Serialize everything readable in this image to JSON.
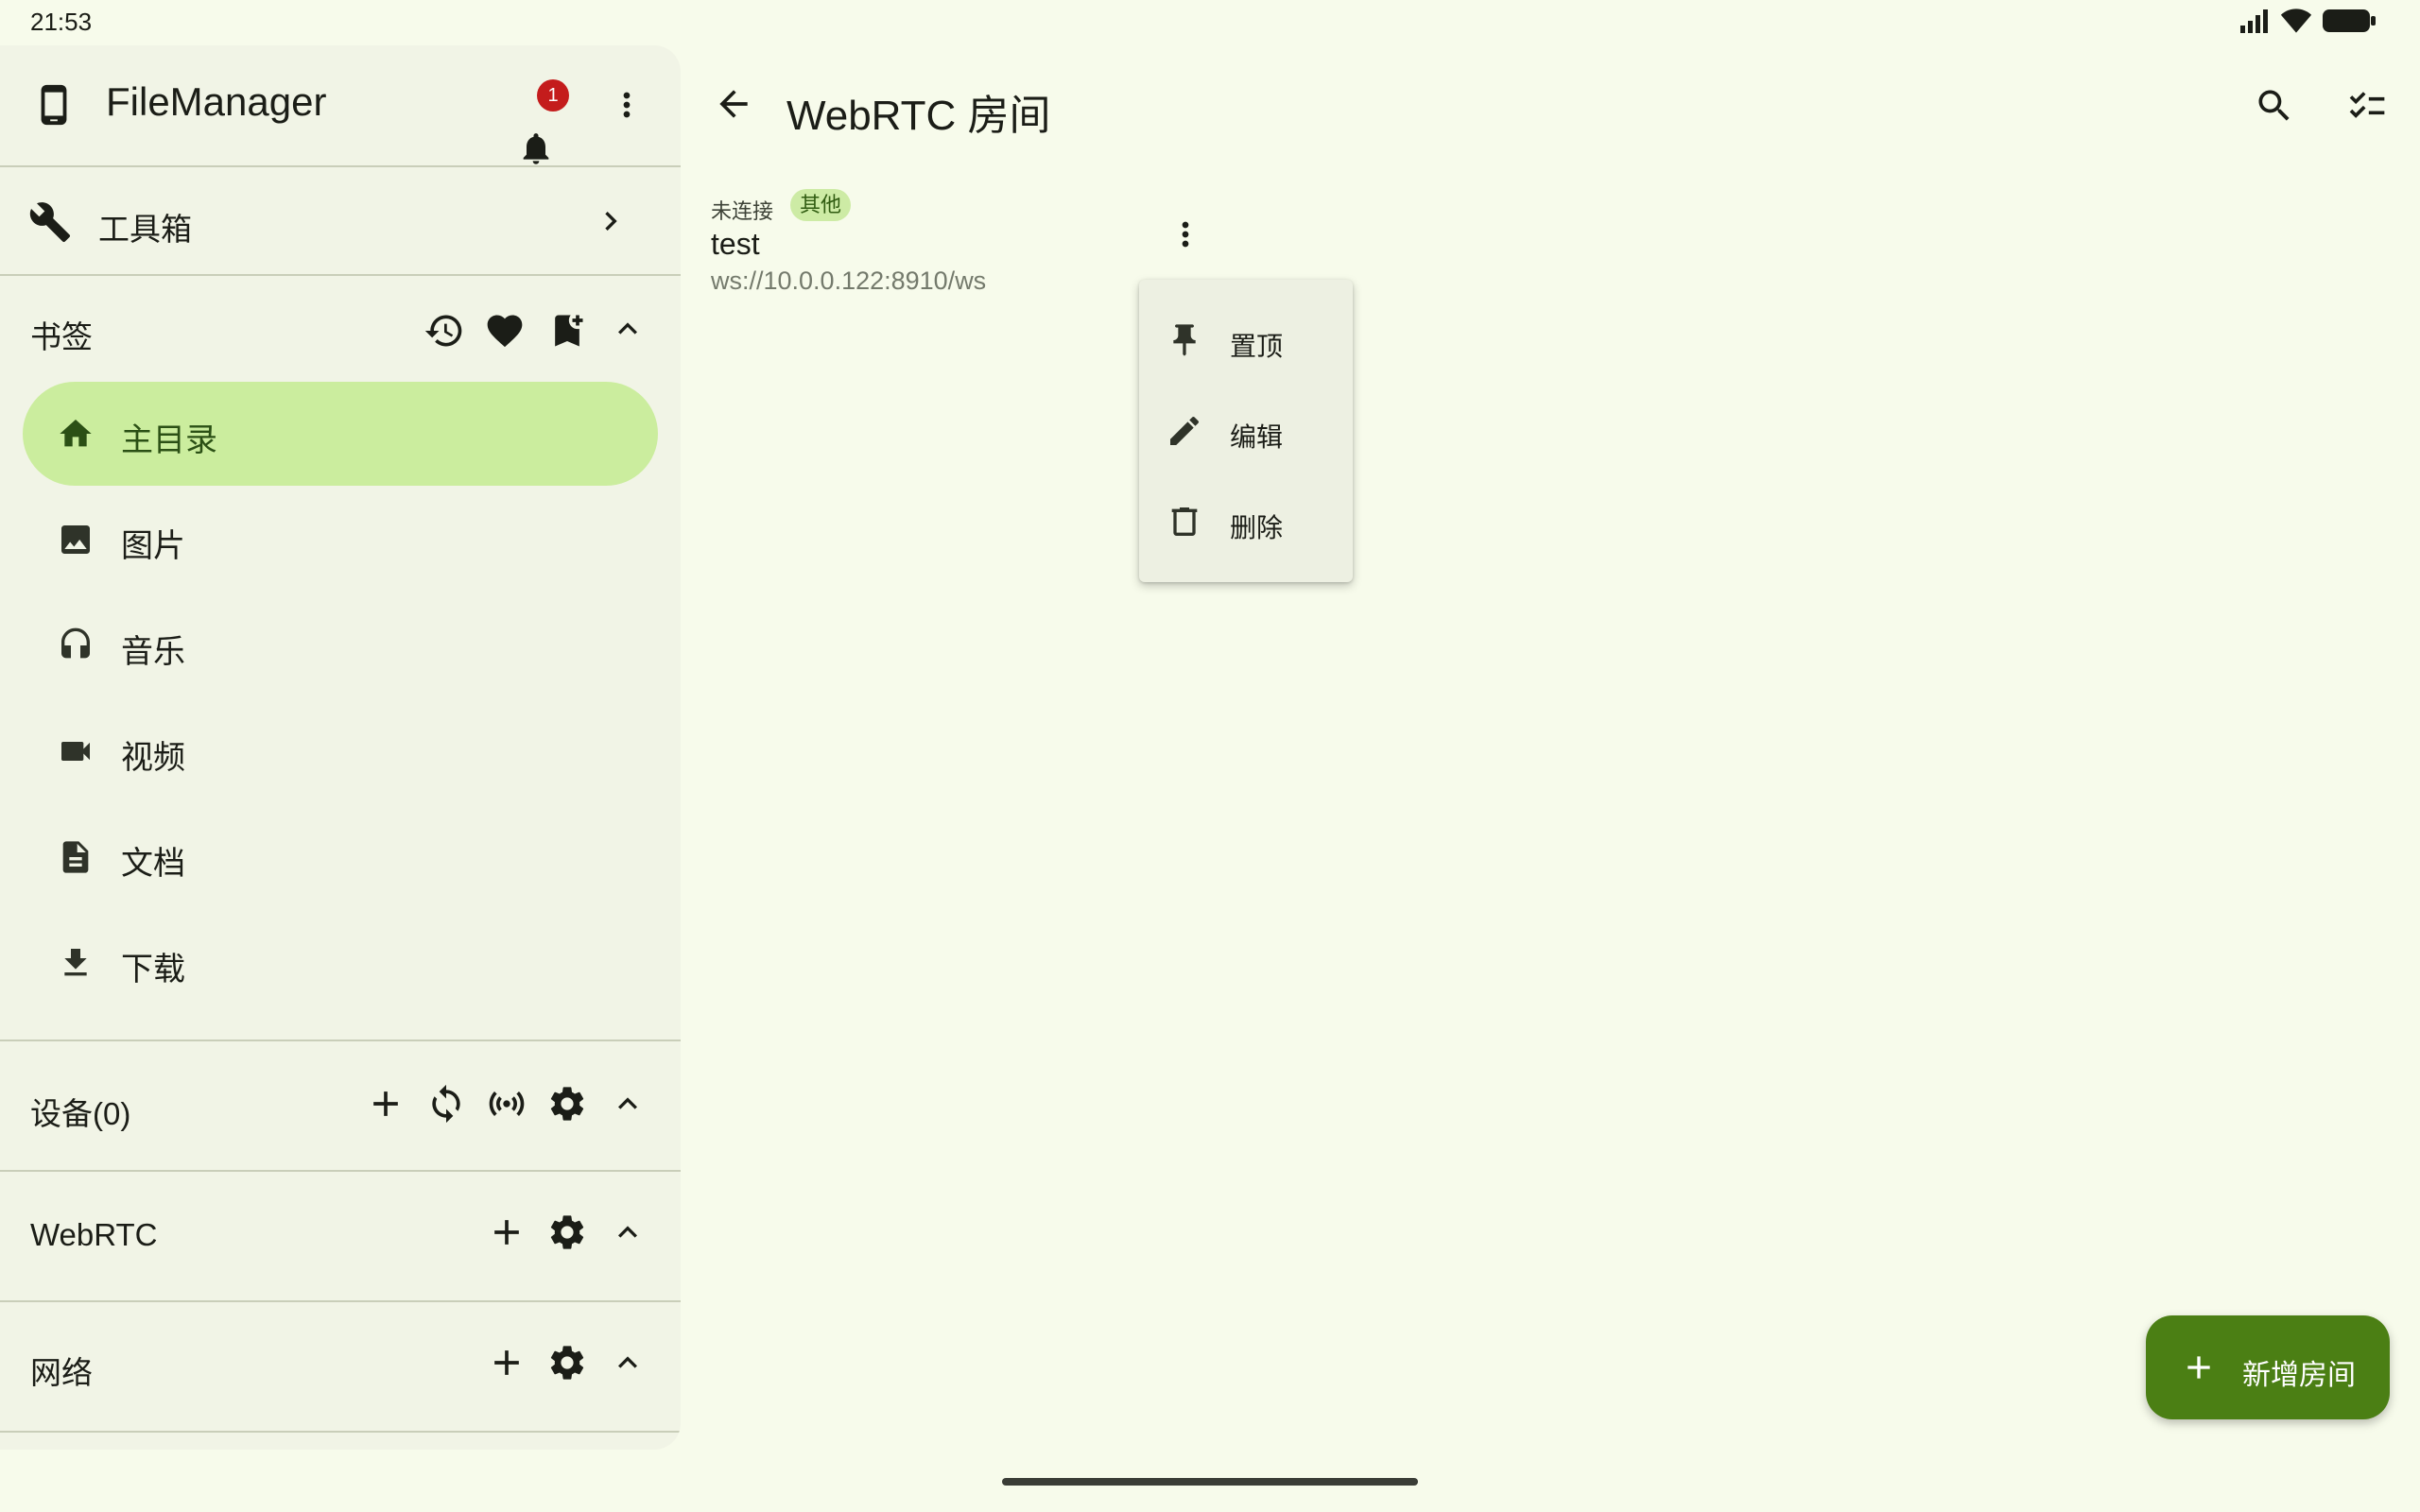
{
  "status_bar": {
    "time": "21:53"
  },
  "drawer": {
    "app_title": "FileManager",
    "notification_count": "1",
    "toolbox_label": "工具箱",
    "bookmarks": {
      "title": "书签",
      "items": [
        {
          "label": "主目录",
          "icon": "home-icon",
          "active": true
        },
        {
          "label": "图片",
          "icon": "image-icon"
        },
        {
          "label": "音乐",
          "icon": "headphones-icon"
        },
        {
          "label": "视频",
          "icon": "videocam-icon"
        },
        {
          "label": "文档",
          "icon": "document-icon"
        },
        {
          "label": "下载",
          "icon": "download-icon"
        }
      ]
    },
    "devices_title": "设备(0)",
    "webrtc_title": "WebRTC",
    "network_title": "网络"
  },
  "main": {
    "title": "WebRTC 房间",
    "room": {
      "status": "未连接",
      "badge": "其他",
      "name": "test",
      "url": "ws://10.0.0.122:8910/ws"
    },
    "menu": {
      "items": [
        {
          "label": "置顶",
          "icon": "pin-icon"
        },
        {
          "label": "编辑",
          "icon": "edit-icon"
        },
        {
          "label": "删除",
          "icon": "delete-icon"
        }
      ]
    },
    "fab_label": "新增房间"
  },
  "colors": {
    "background": "#f7fbeb",
    "drawer": "#f1f4e6",
    "active_item": "#cbed9e",
    "fab": "#4b7f14",
    "badge_bg": "#cdeba5",
    "notification": "#c41c1c"
  }
}
